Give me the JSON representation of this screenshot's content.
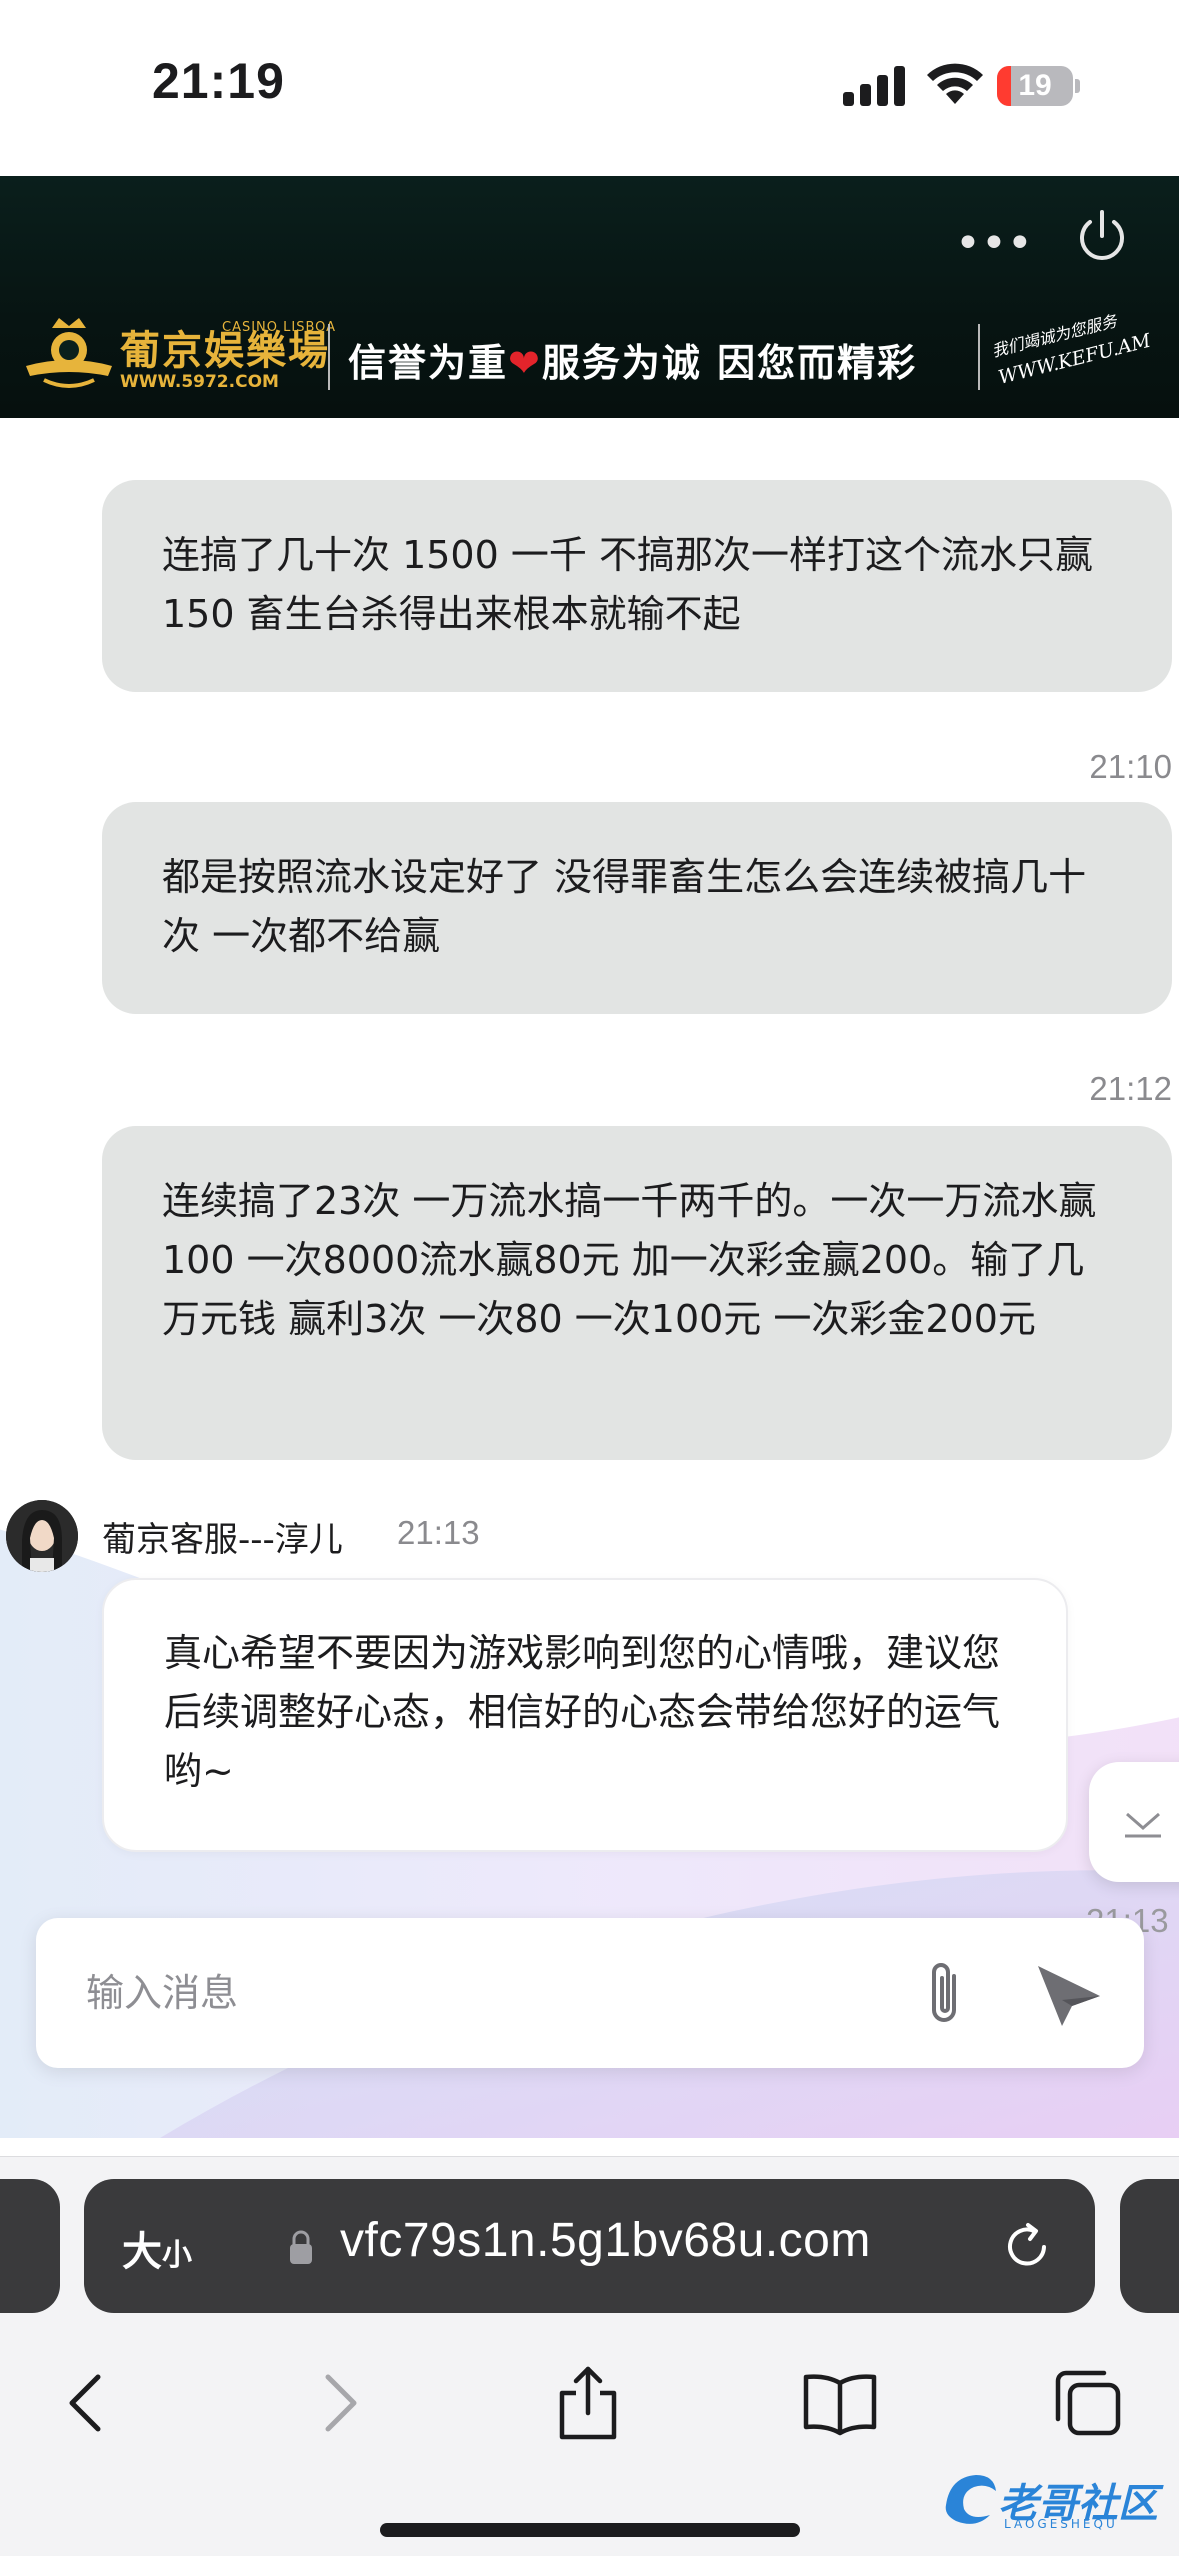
{
  "status_bar": {
    "time": "21:19",
    "battery": "19",
    "battery_level": 0.19
  },
  "header": {
    "logo_name": "葡京娱樂場",
    "logo_name_en": "CASINO LISBOA",
    "logo_url": "WWW.5972.COM",
    "slogan_left": "信誉为重",
    "slogan_right": "服务为诚  因您而精彩",
    "kefu_cn": "我们竭诚为您服务",
    "kefu_url": "WWW.KEFU.AM",
    "more_icon": "more-icon",
    "power_icon": "power-icon"
  },
  "messages": [
    {
      "type": "user",
      "text": "连搞了几十次 1500 一千 不搞那次一样打这个流水只赢150 畜生台杀得出来根本就输不起"
    },
    {
      "type": "user",
      "time": "21:10",
      "text": "都是按照流水设定好了 没得罪畜生怎么会连续被搞几十次 一次都不给赢"
    },
    {
      "type": "user",
      "time": "21:12",
      "text": "连续搞了23次 一万流水搞一千两千的。一次一万流水赢100 一次8000流水赢80元 加一次彩金赢200。输了几万元钱 赢利3次 一次80 一次100元 一次彩金200元"
    }
  ],
  "agent": {
    "name": "葡京客服---淳儿",
    "time": "21:13",
    "text": "真心希望不要因为游戏影响到您的心情哦，建议您后续调整好心态，相信好的心态会带给您好的运气哟~"
  },
  "partial_timestamp": "21:13",
  "input": {
    "placeholder": "输入消息",
    "value": ""
  },
  "browser": {
    "size_label": "大",
    "size_small": "小",
    "url": "vfc79s1n.5g1bv68u.com"
  },
  "watermark": {
    "text": "老哥社区",
    "sub": "LAOGESHEQU"
  },
  "colors": {
    "user_bubble": "#e2e4e3",
    "banner_bg": "#0a1f1c",
    "gold": "#e7b43b",
    "heart": "#e3242b",
    "url_bar": "#3a3a3c"
  }
}
